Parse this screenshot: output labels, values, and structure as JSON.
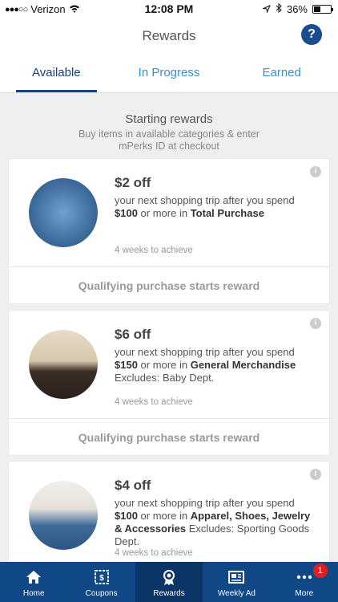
{
  "status": {
    "carrier": "Verizon",
    "time": "12:08 PM",
    "battery": "36%"
  },
  "header": {
    "title": "Rewards",
    "help_icon": "question-mark-icon"
  },
  "tabs": [
    {
      "label": "Available",
      "active": true
    },
    {
      "label": "In Progress",
      "active": false
    },
    {
      "label": "Earned",
      "active": false
    }
  ],
  "intro": {
    "heading": "Starting rewards",
    "sub1": "Buy items in available categories & enter",
    "sub2": "mPerks ID at checkout"
  },
  "cards": [
    {
      "amount": "$2 off",
      "line1": "your next shopping trip after you spend",
      "spend": "$100",
      "mid": "or more in",
      "category": "Total Purchase",
      "excludes": "",
      "eta": "4 weeks to achieve",
      "footer": "Qualifying purchase starts reward"
    },
    {
      "amount": "$6 off",
      "line1": "your next shopping trip after you spend",
      "spend": "$150",
      "mid": "or more in",
      "category": "General Merchandise",
      "excludes": "Excludes: Baby Dept.",
      "eta": "4 weeks to achieve",
      "footer": "Qualifying purchase starts reward"
    },
    {
      "amount": "$4 off",
      "line1": "your next shopping trip after you spend",
      "spend": "$100",
      "mid": "or more in",
      "category": "Apparel, Shoes, Jewelry & Accessories",
      "excludes": "Excludes: Sporting Goods Dept.",
      "eta": "4 weeks to achieve",
      "footer": ""
    }
  ],
  "nav": [
    {
      "label": "Home",
      "icon": "home-icon",
      "active": false
    },
    {
      "label": "Coupons",
      "icon": "coupon-icon",
      "active": false
    },
    {
      "label": "Rewards",
      "icon": "rewards-icon",
      "active": true
    },
    {
      "label": "Weekly Ad",
      "icon": "weekly-ad-icon",
      "active": false
    },
    {
      "label": "More",
      "icon": "more-icon",
      "active": false,
      "badge": "1"
    }
  ]
}
